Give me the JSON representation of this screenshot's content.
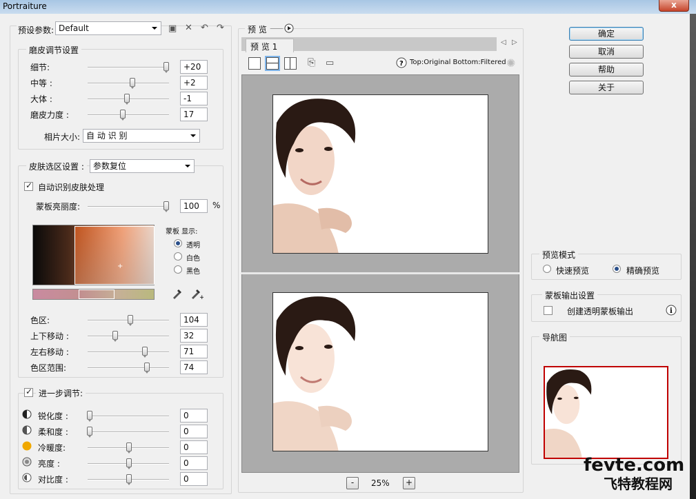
{
  "window": {
    "title": "Portraiture",
    "close_label": "x"
  },
  "preset": {
    "label": "预设参数:",
    "value": "Default"
  },
  "smoothing": {
    "title": "磨皮调节设置",
    "rows": [
      {
        "label": "细节:",
        "value": "+20"
      },
      {
        "label": "中等 :",
        "value": "+2"
      },
      {
        "label": "大体 :",
        "value": "-1"
      },
      {
        "label": "磨皮力度 :",
        "value": "17"
      }
    ],
    "photo_size_label": "相片大小:",
    "photo_size_value": "自 动 识 别"
  },
  "skin": {
    "title": "皮肤选区设置 :",
    "reset_value": "参数复位",
    "auto_label": "自动识别皮肤处理",
    "mask_brightness_label": "蒙板亮丽度:",
    "mask_brightness_value": "100",
    "mask_brightness_unit": "%",
    "mask_display_label": "蒙板 显示:",
    "display_options": [
      "透明",
      "白色",
      "黑色"
    ],
    "rows": [
      {
        "label": "色区:",
        "value": "104"
      },
      {
        "label": "上下移动 :",
        "value": "32"
      },
      {
        "label": "左右移动 :",
        "value": "71"
      },
      {
        "label": "色区范围:",
        "value": "74"
      }
    ]
  },
  "enhance": {
    "title": "进一步调节:",
    "rows": [
      {
        "label": "锐化度 :",
        "value": "0"
      },
      {
        "label": "柔和度 :",
        "value": "0"
      },
      {
        "label": "冷暖度:",
        "value": "0"
      },
      {
        "label": "亮度 :",
        "value": "0"
      },
      {
        "label": "对比度 :",
        "value": "0"
      }
    ]
  },
  "preview": {
    "title": "预 览",
    "tab": "预 览  1",
    "info": "Top:Original Bottom:Filtered",
    "zoom": "25%",
    "zoom_minus": "-",
    "zoom_plus": "+"
  },
  "buttons": {
    "ok": "确定",
    "cancel": "取消",
    "help": "帮助",
    "about": "关于"
  },
  "preview_mode": {
    "title": "预览模式",
    "fast": "快速预览",
    "accurate": "精确预览"
  },
  "mask_output": {
    "title": "蒙板输出设置",
    "transparent_label": "创建透明蒙板输出"
  },
  "navigator": {
    "title": "导航图"
  },
  "watermark": {
    "line1": "fevte.com",
    "line2": "飞特教程网"
  }
}
